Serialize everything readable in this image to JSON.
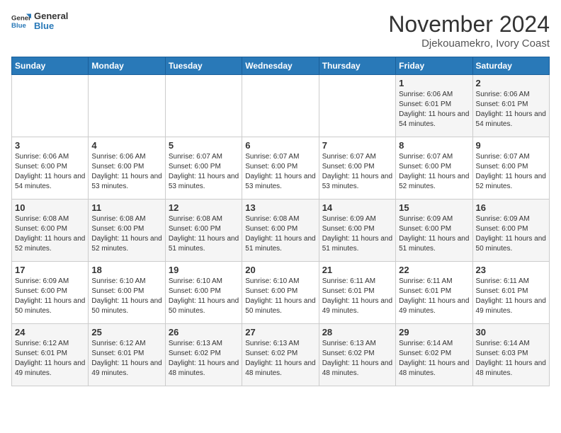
{
  "header": {
    "logo_line1": "General",
    "logo_line2": "Blue",
    "month_year": "November 2024",
    "location": "Djekouamekro, Ivory Coast"
  },
  "weekdays": [
    "Sunday",
    "Monday",
    "Tuesday",
    "Wednesday",
    "Thursday",
    "Friday",
    "Saturday"
  ],
  "weeks": [
    [
      {
        "day": "",
        "info": ""
      },
      {
        "day": "",
        "info": ""
      },
      {
        "day": "",
        "info": ""
      },
      {
        "day": "",
        "info": ""
      },
      {
        "day": "",
        "info": ""
      },
      {
        "day": "1",
        "info": "Sunrise: 6:06 AM\nSunset: 6:01 PM\nDaylight: 11 hours and 54 minutes."
      },
      {
        "day": "2",
        "info": "Sunrise: 6:06 AM\nSunset: 6:01 PM\nDaylight: 11 hours and 54 minutes."
      }
    ],
    [
      {
        "day": "3",
        "info": "Sunrise: 6:06 AM\nSunset: 6:00 PM\nDaylight: 11 hours and 54 minutes."
      },
      {
        "day": "4",
        "info": "Sunrise: 6:06 AM\nSunset: 6:00 PM\nDaylight: 11 hours and 53 minutes."
      },
      {
        "day": "5",
        "info": "Sunrise: 6:07 AM\nSunset: 6:00 PM\nDaylight: 11 hours and 53 minutes."
      },
      {
        "day": "6",
        "info": "Sunrise: 6:07 AM\nSunset: 6:00 PM\nDaylight: 11 hours and 53 minutes."
      },
      {
        "day": "7",
        "info": "Sunrise: 6:07 AM\nSunset: 6:00 PM\nDaylight: 11 hours and 53 minutes."
      },
      {
        "day": "8",
        "info": "Sunrise: 6:07 AM\nSunset: 6:00 PM\nDaylight: 11 hours and 52 minutes."
      },
      {
        "day": "9",
        "info": "Sunrise: 6:07 AM\nSunset: 6:00 PM\nDaylight: 11 hours and 52 minutes."
      }
    ],
    [
      {
        "day": "10",
        "info": "Sunrise: 6:08 AM\nSunset: 6:00 PM\nDaylight: 11 hours and 52 minutes."
      },
      {
        "day": "11",
        "info": "Sunrise: 6:08 AM\nSunset: 6:00 PM\nDaylight: 11 hours and 52 minutes."
      },
      {
        "day": "12",
        "info": "Sunrise: 6:08 AM\nSunset: 6:00 PM\nDaylight: 11 hours and 51 minutes."
      },
      {
        "day": "13",
        "info": "Sunrise: 6:08 AM\nSunset: 6:00 PM\nDaylight: 11 hours and 51 minutes."
      },
      {
        "day": "14",
        "info": "Sunrise: 6:09 AM\nSunset: 6:00 PM\nDaylight: 11 hours and 51 minutes."
      },
      {
        "day": "15",
        "info": "Sunrise: 6:09 AM\nSunset: 6:00 PM\nDaylight: 11 hours and 51 minutes."
      },
      {
        "day": "16",
        "info": "Sunrise: 6:09 AM\nSunset: 6:00 PM\nDaylight: 11 hours and 50 minutes."
      }
    ],
    [
      {
        "day": "17",
        "info": "Sunrise: 6:09 AM\nSunset: 6:00 PM\nDaylight: 11 hours and 50 minutes."
      },
      {
        "day": "18",
        "info": "Sunrise: 6:10 AM\nSunset: 6:00 PM\nDaylight: 11 hours and 50 minutes."
      },
      {
        "day": "19",
        "info": "Sunrise: 6:10 AM\nSunset: 6:00 PM\nDaylight: 11 hours and 50 minutes."
      },
      {
        "day": "20",
        "info": "Sunrise: 6:10 AM\nSunset: 6:00 PM\nDaylight: 11 hours and 50 minutes."
      },
      {
        "day": "21",
        "info": "Sunrise: 6:11 AM\nSunset: 6:01 PM\nDaylight: 11 hours and 49 minutes."
      },
      {
        "day": "22",
        "info": "Sunrise: 6:11 AM\nSunset: 6:01 PM\nDaylight: 11 hours and 49 minutes."
      },
      {
        "day": "23",
        "info": "Sunrise: 6:11 AM\nSunset: 6:01 PM\nDaylight: 11 hours and 49 minutes."
      }
    ],
    [
      {
        "day": "24",
        "info": "Sunrise: 6:12 AM\nSunset: 6:01 PM\nDaylight: 11 hours and 49 minutes."
      },
      {
        "day": "25",
        "info": "Sunrise: 6:12 AM\nSunset: 6:01 PM\nDaylight: 11 hours and 49 minutes."
      },
      {
        "day": "26",
        "info": "Sunrise: 6:13 AM\nSunset: 6:02 PM\nDaylight: 11 hours and 48 minutes."
      },
      {
        "day": "27",
        "info": "Sunrise: 6:13 AM\nSunset: 6:02 PM\nDaylight: 11 hours and 48 minutes."
      },
      {
        "day": "28",
        "info": "Sunrise: 6:13 AM\nSunset: 6:02 PM\nDaylight: 11 hours and 48 minutes."
      },
      {
        "day": "29",
        "info": "Sunrise: 6:14 AM\nSunset: 6:02 PM\nDaylight: 11 hours and 48 minutes."
      },
      {
        "day": "30",
        "info": "Sunrise: 6:14 AM\nSunset: 6:03 PM\nDaylight: 11 hours and 48 minutes."
      }
    ]
  ]
}
